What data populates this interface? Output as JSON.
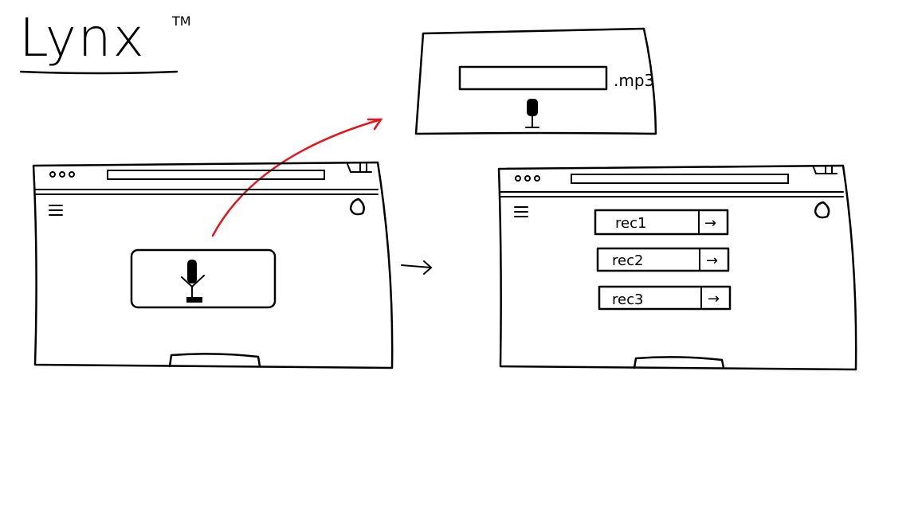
{
  "title": {
    "text": "Lynx",
    "trademark": "TM"
  },
  "popup": {
    "extension_label": ".mp3",
    "icon": "microphone-icon"
  },
  "left_window": {
    "menu_icon": "hamburger-icon",
    "record_icon": "microphone-icon"
  },
  "right_window": {
    "recordings": [
      {
        "label": "rec1",
        "action": "→"
      },
      {
        "label": "rec2",
        "action": "→"
      },
      {
        "label": "rec3",
        "action": "→"
      }
    ]
  },
  "flow_arrow": "→",
  "colors": {
    "ink": "#000000",
    "arrow": "#e8141b",
    "paper": "#ffffff"
  }
}
